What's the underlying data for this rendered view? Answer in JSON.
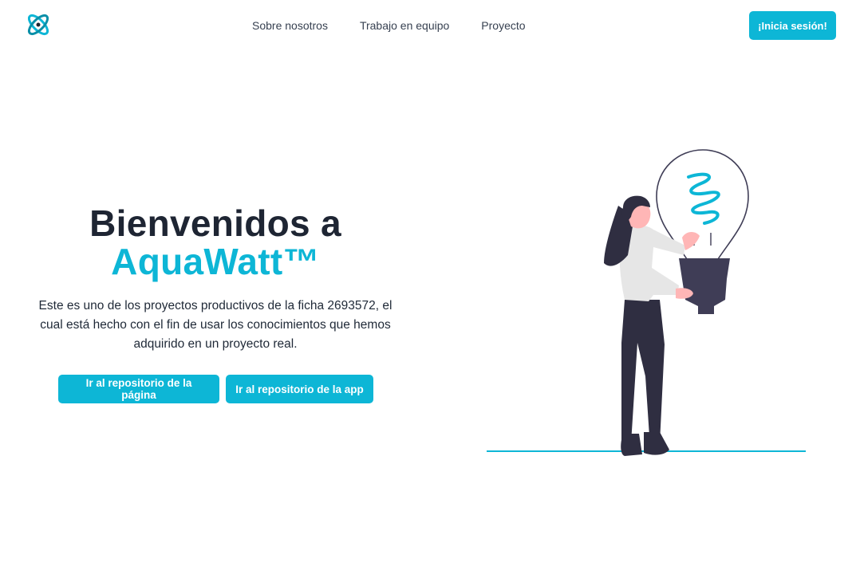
{
  "brand": {
    "logo_icon": "atom-logo-icon",
    "accent_color": "#0db6d6"
  },
  "nav": {
    "links": [
      "Sobre nosotros",
      "Trabajo en equipo",
      "Proyecto"
    ],
    "login_label": "¡Inicia sesión!"
  },
  "hero": {
    "title_line1": "Bienvenidos a",
    "title_line2": "AquaWatt™",
    "description": "Este es uno de los proyectos productivos de la ficha 2693572, el cual está hecho con el fin de usar los conocimientos que hemos adquirido en un proyecto real.",
    "buttons": {
      "page_repo": "Ir al repositorio de la página",
      "app_repo": "Ir al repositorio de la app"
    }
  },
  "illustration": {
    "icon": "woman-holding-lightbulb-illustration"
  }
}
